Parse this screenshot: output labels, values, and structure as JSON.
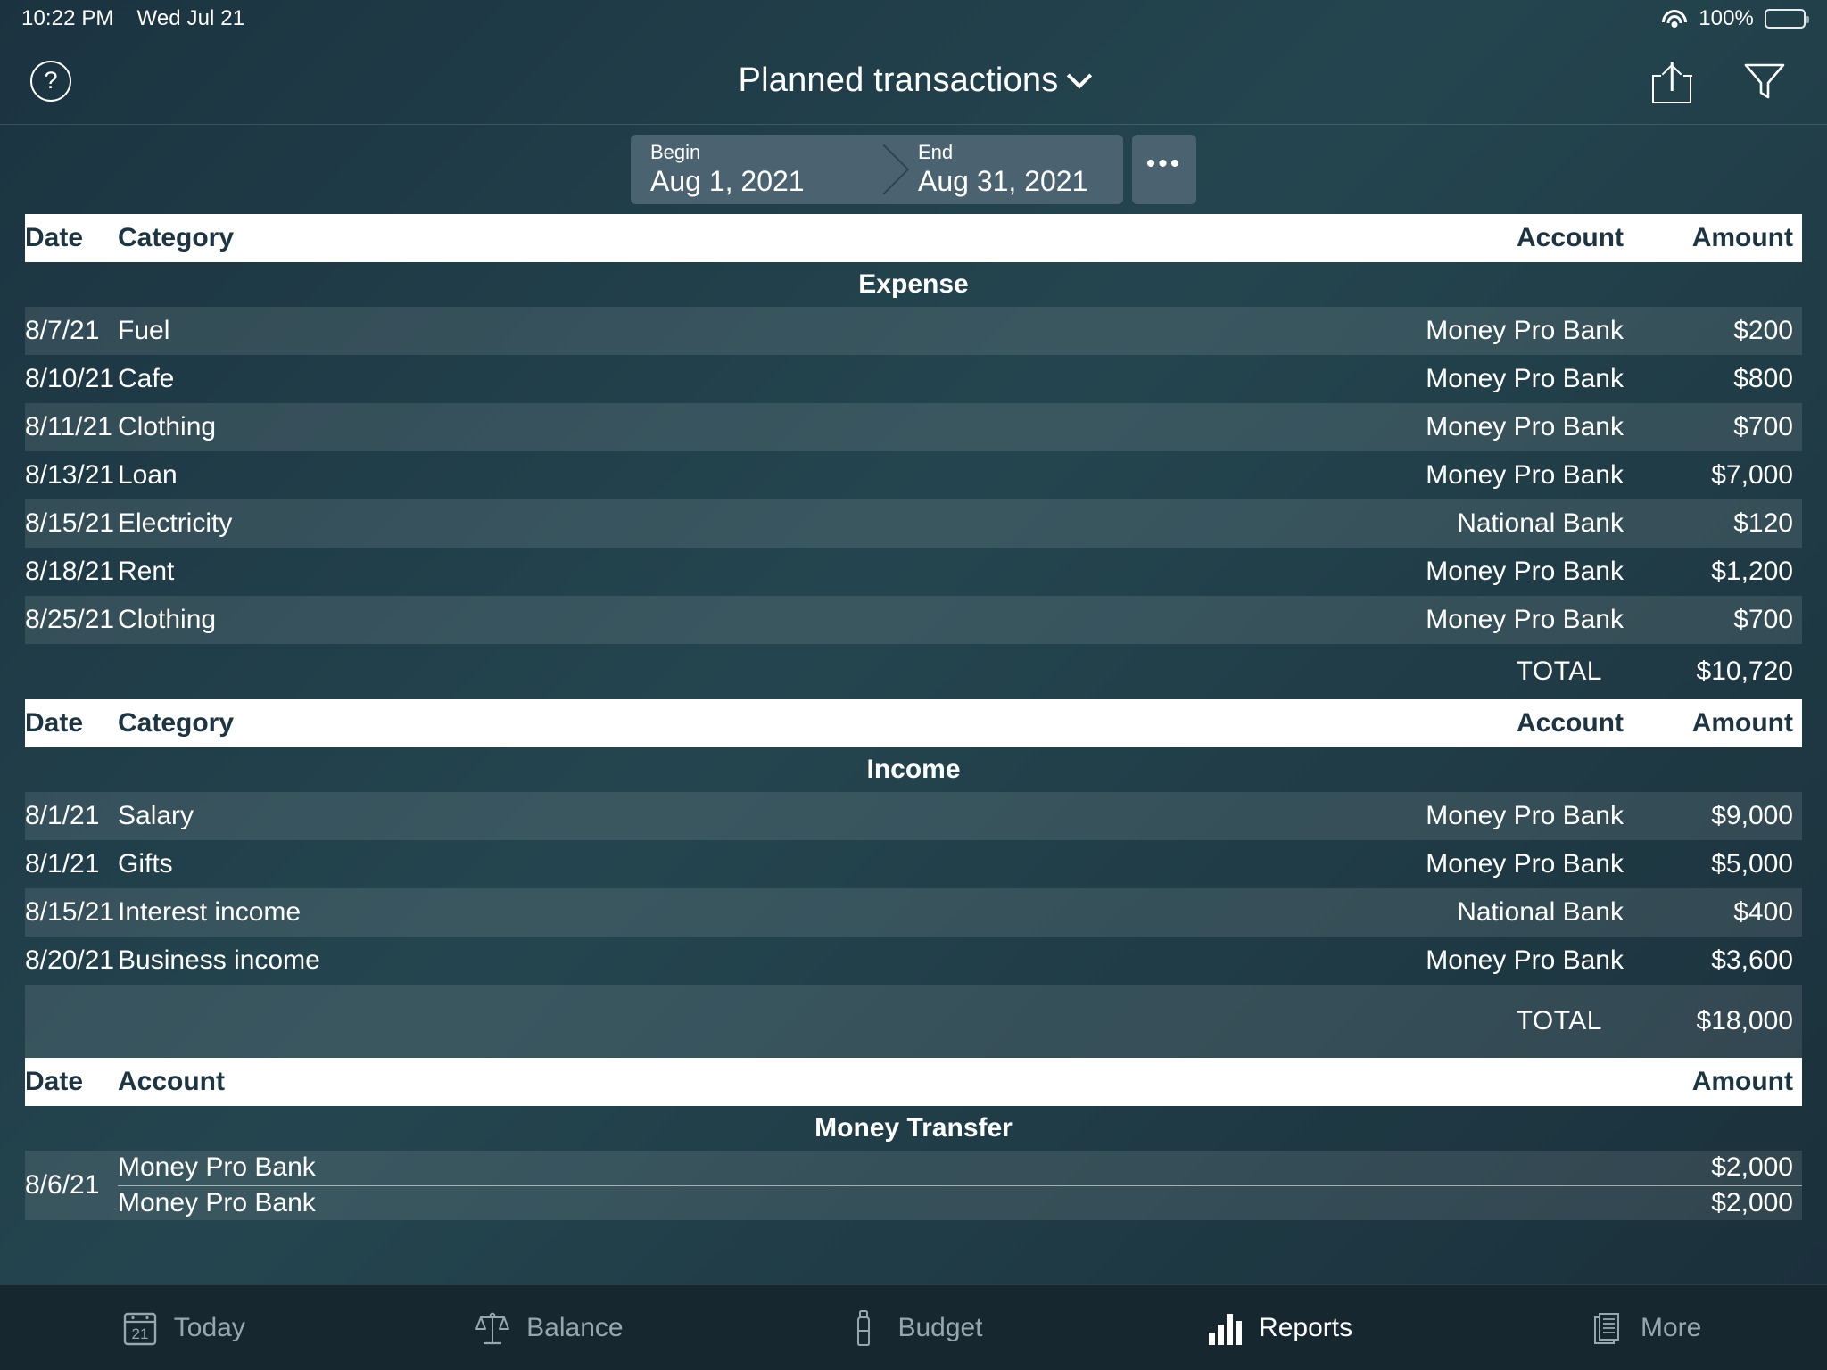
{
  "status_bar": {
    "time": "10:22 PM",
    "date": "Wed Jul 21",
    "battery_percent": "100%",
    "wifi_icon": "wifi-icon",
    "battery_icon": "battery-icon"
  },
  "nav": {
    "help_label": "?",
    "title": "Planned transactions",
    "title_chevron_icon": "chevron-down-icon",
    "share_icon": "share-icon",
    "filter_icon": "filter-icon"
  },
  "period": {
    "begin_label": "Begin",
    "begin_value": "Aug 1, 2021",
    "end_label": "End",
    "end_value": "Aug 31, 2021",
    "more_label": "•••",
    "segment_bg": "#4b6370"
  },
  "sections": [
    {
      "id": "expense",
      "title": "Expense",
      "columns": {
        "date": "Date",
        "category": "Category",
        "account": "Account",
        "amount": "Amount"
      },
      "rows": [
        {
          "date": "8/7/21",
          "category": "Fuel",
          "account": "Money Pro Bank",
          "amount": "$200"
        },
        {
          "date": "8/10/21",
          "category": "Cafe",
          "account": "Money Pro Bank",
          "amount": "$800"
        },
        {
          "date": "8/11/21",
          "category": "Clothing",
          "account": "Money Pro Bank",
          "amount": "$700"
        },
        {
          "date": "8/13/21",
          "category": "Loan",
          "account": "Money Pro Bank",
          "amount": "$7,000"
        },
        {
          "date": "8/15/21",
          "category": "Electricity",
          "account": "National Bank",
          "amount": "$120"
        },
        {
          "date": "8/18/21",
          "category": "Rent",
          "account": "Money Pro Bank",
          "amount": "$1,200"
        },
        {
          "date": "8/25/21",
          "category": "Clothing",
          "account": "Money Pro Bank",
          "amount": "$700"
        }
      ],
      "total_label": "TOTAL",
      "total_value": "$10,720"
    },
    {
      "id": "income",
      "title": "Income",
      "columns": {
        "date": "Date",
        "category": "Category",
        "account": "Account",
        "amount": "Amount"
      },
      "rows": [
        {
          "date": "8/1/21",
          "category": "Salary",
          "account": "Money Pro Bank",
          "amount": "$9,000"
        },
        {
          "date": "8/1/21",
          "category": "Gifts",
          "account": "Money Pro Bank",
          "amount": "$5,000"
        },
        {
          "date": "8/15/21",
          "category": "Interest income",
          "account": "National Bank",
          "amount": "$400"
        },
        {
          "date": "8/20/21",
          "category": "Business income",
          "account": "Money Pro Bank",
          "amount": "$3,600"
        }
      ],
      "total_label": "TOTAL",
      "total_value": "$18,000"
    },
    {
      "id": "money_transfer",
      "title": "Money Transfer",
      "columns": {
        "date": "Date",
        "account": "Account",
        "amount": "Amount"
      },
      "transfer": {
        "date": "8/6/21",
        "from_account": "Money Pro Bank",
        "from_amount": "$2,000",
        "to_account": "Money Pro Bank",
        "to_amount": "$2,000"
      }
    }
  ],
  "tabbar": {
    "tabs": [
      {
        "label": "Today",
        "icon": "calendar-icon",
        "icon_text": "21",
        "active": false
      },
      {
        "label": "Balance",
        "icon": "scales-icon",
        "active": false
      },
      {
        "label": "Budget",
        "icon": "bottle-icon",
        "active": false
      },
      {
        "label": "Reports",
        "icon": "bar-chart-icon",
        "active": true
      },
      {
        "label": "More",
        "icon": "documents-icon",
        "active": false
      }
    ]
  }
}
